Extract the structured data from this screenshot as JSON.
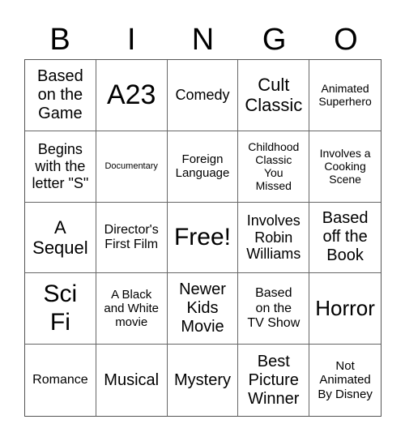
{
  "header": [
    "B",
    "I",
    "N",
    "G",
    "O"
  ],
  "cells": [
    "Based\non the\nGame",
    "A23",
    "Comedy",
    "Cult\nClassic",
    "Animated\nSuperhero",
    "Begins\nwith the\nletter \"S\"",
    "Documentary",
    "Foreign\nLanguage",
    "Childhood\nClassic\nYou\nMissed",
    "Involves a\nCooking\nScene",
    "A\nSequel",
    "Director's\nFirst Film",
    "Free!",
    "Involves\nRobin\nWilliams",
    "Based\noff the\nBook",
    "Sci\nFi",
    "A Black\nand White\nmovie",
    "Newer\nKids\nMovie",
    "Based\non the\nTV Show",
    "Horror",
    "Romance",
    "Musical",
    "Mystery",
    "Best\nPicture\nWinner",
    "Not\nAnimated\nBy Disney"
  ]
}
